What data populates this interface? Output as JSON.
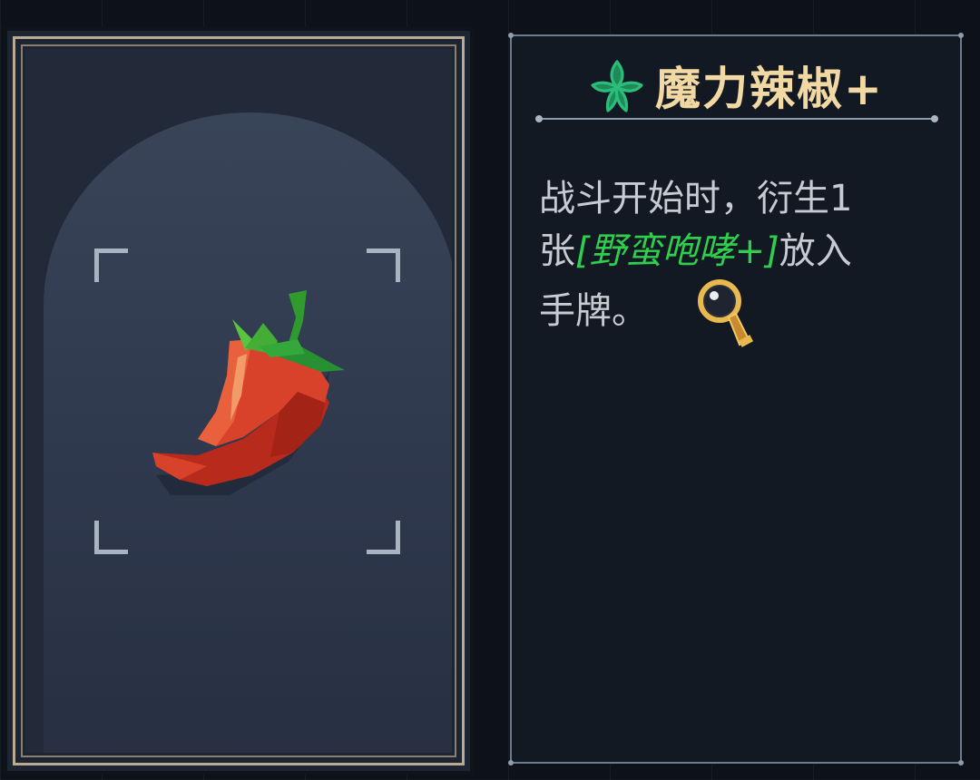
{
  "item": {
    "title": "魔力辣椒+",
    "icon": "chili-pepper-icon",
    "rarity_icon": "leaf-icon",
    "description": {
      "line1": "战斗开始时，衍生1",
      "line2_prefix": "张",
      "keyword": "[野蛮咆哮+]",
      "line2_suffix": "放入",
      "line3": "手牌。"
    },
    "inspect_icon": "magnifier-icon"
  },
  "colors": {
    "title": "#f2d9a3",
    "keyword": "#2fce4e",
    "description_text": "#c7ccd3",
    "card_frame": "#b9ab93",
    "panel_bg": "#131923",
    "leaf": "#2bbd7a"
  }
}
